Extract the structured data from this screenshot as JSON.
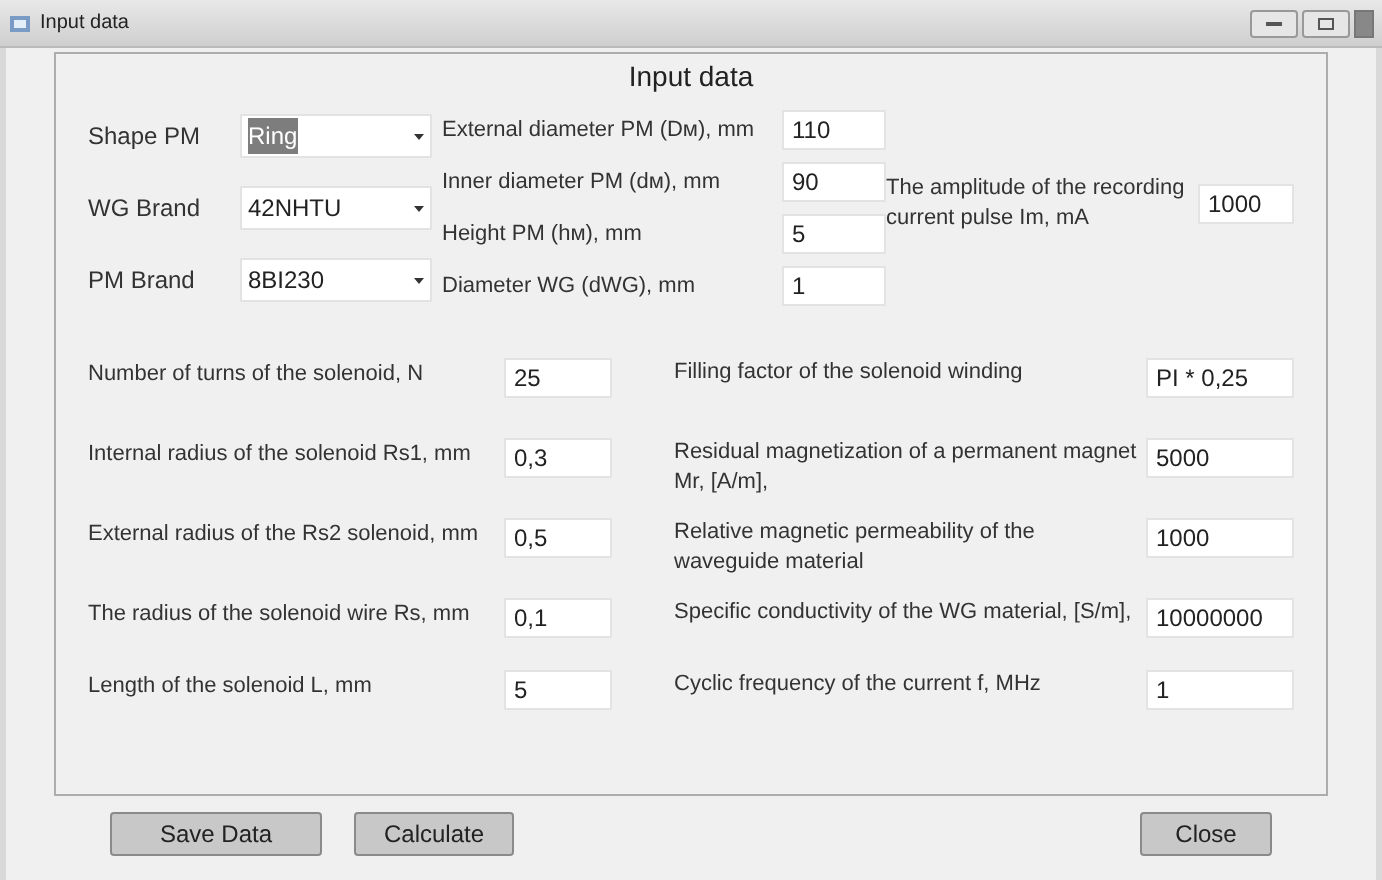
{
  "window": {
    "title": "Input data"
  },
  "panel_title": "Input data",
  "combos": [
    {
      "label": "Shape PM",
      "value": "Ring",
      "text_highlighted": true
    },
    {
      "label": "WG Brand",
      "value": "42NHTU",
      "text_highlighted": false
    },
    {
      "label": "PM Brand",
      "value": "8BI230",
      "text_highlighted": false
    }
  ],
  "pm_fields": [
    {
      "label": "External  diameter PM (Dм), mm",
      "value": "110"
    },
    {
      "label": "Inner diameter PM (dм), mm",
      "value": "90"
    },
    {
      "label": "Height PM (hм), mm",
      "value": "5"
    },
    {
      "label": "Diameter WG (dWG), mm",
      "value": "1"
    }
  ],
  "pulse_field": {
    "label": "The amplitude of the recording current pulse Im, mA",
    "value": "1000"
  },
  "solenoid_fields": [
    {
      "label": "Number of turns of the solenoid, N",
      "value": "25"
    },
    {
      "label": "Internal radius of the solenoid Rs1, mm",
      "value": "0,3"
    },
    {
      "label": "External radius of the Rs2 solenoid, mm",
      "value": "0,5"
    },
    {
      "label": "The radius of the solenoid wire Rs, mm",
      "value": "0,1"
    },
    {
      "label": "Length of the solenoid L, mm",
      "value": "5"
    }
  ],
  "material_fields": [
    {
      "label": "Filling factor of the solenoid winding",
      "value": "PI * 0,25"
    },
    {
      "label": "Residual magnetization of a permanent magnet Mr, [A/m],",
      "value": "5000"
    },
    {
      "label": "Relative magnetic permeability of the waveguide material",
      "value": "1000"
    },
    {
      "label": "Specific conductivity of the WG  material, [S/m],",
      "value": "10000000"
    },
    {
      "label": "Cyclic frequency of the current f, MHz",
      "value": "1"
    }
  ],
  "buttons": [
    {
      "label": "Save Data"
    },
    {
      "label": "Calculate"
    },
    {
      "label": "Close"
    }
  ]
}
